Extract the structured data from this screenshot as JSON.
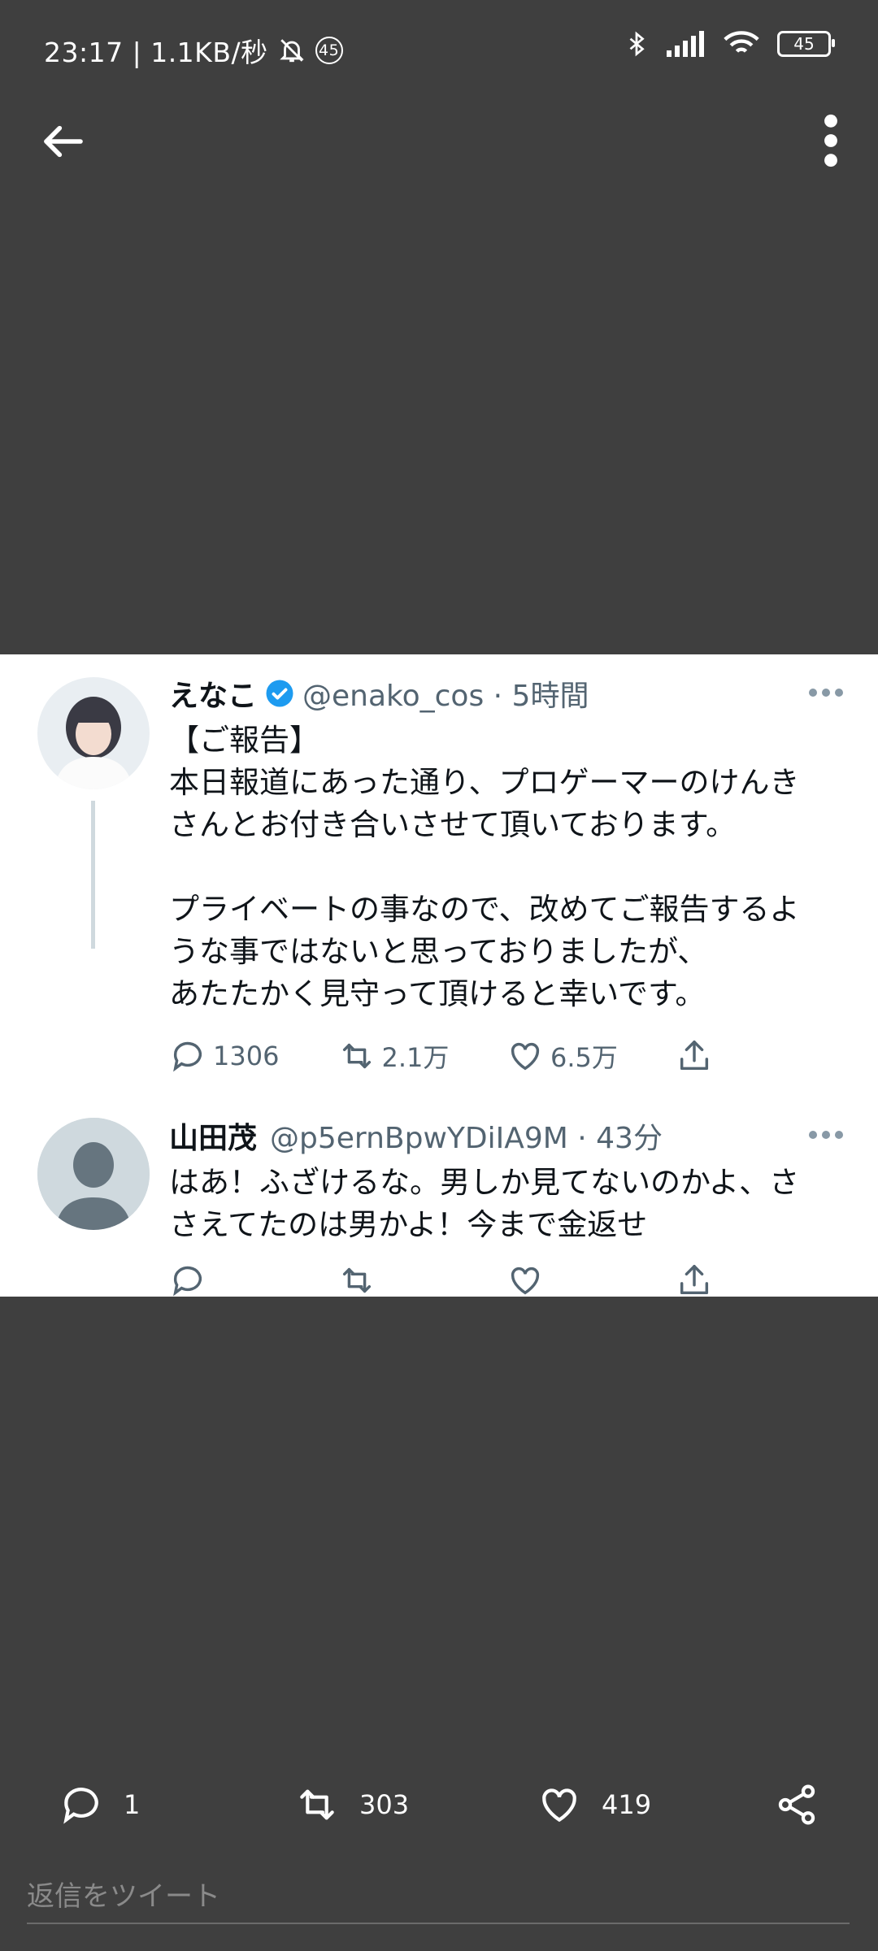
{
  "status_bar": {
    "time_speed": "23:17 | 1.1KB/秒",
    "notification_count": "45",
    "battery": "45"
  },
  "icons": {
    "back": "arrow-left-icon",
    "more": "more-vertical-icon",
    "verified": "verified-badge-icon",
    "reply": "reply-icon",
    "retweet": "retweet-icon",
    "like": "heart-icon",
    "share": "share-icon"
  },
  "colors": {
    "background": "#3f3f3f",
    "verified": "#1d9bf0",
    "muted": "#536471"
  },
  "tweet1": {
    "name": "えなこ",
    "handle": "@enako_cos · 5時間",
    "body": "【ご報告】\n本日報道にあった通り、プロゲーマーのけんき\nさんとお付き合いさせて頂いております。\n\nプライベートの事なので、改めてご報告するよ\nうな事ではないと思っておりましたが、\nあたたかく見守って頂けると幸いです。",
    "replies": "1306",
    "retweets": "2.1万",
    "likes": "6.5万"
  },
  "tweet2": {
    "name": "山田茂",
    "handle": "@p5ernBpwYDiIA9M · 43分",
    "body": "はあ！ふざけるな。男しか見てないのかよ、さ\nさえてたのは男かよ！今まで金返せ"
  },
  "bottom_bar": {
    "replies": "1",
    "retweets": "303",
    "likes": "419",
    "reply_placeholder": "返信をツイート"
  }
}
